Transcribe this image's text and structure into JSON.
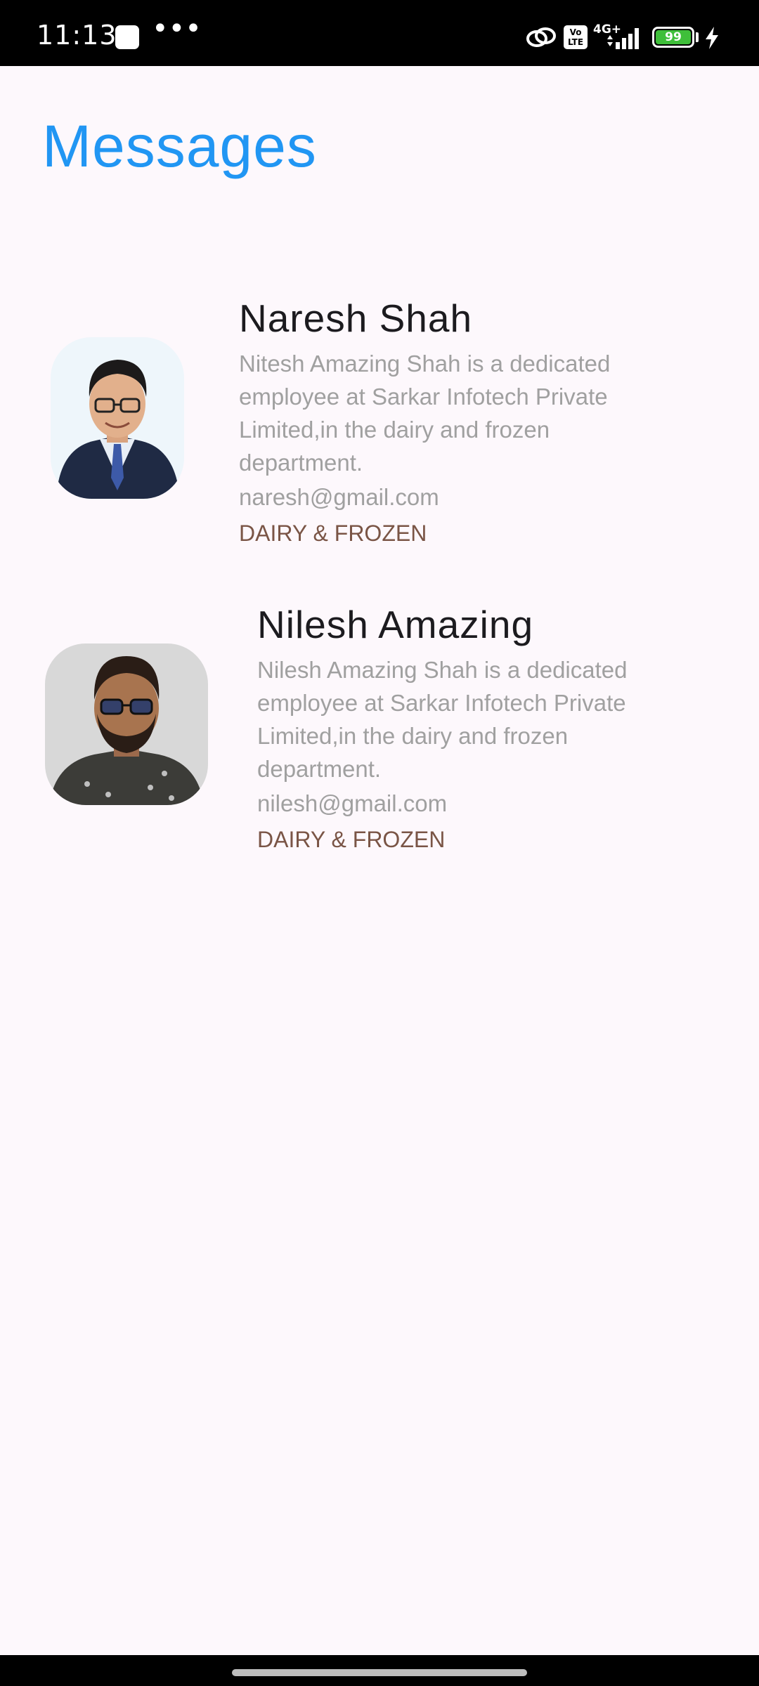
{
  "status_bar": {
    "time": "11:13",
    "dots": "•••",
    "volte": "Vo LTE",
    "network": "4G+",
    "battery": "99",
    "battery_color": "#3fbf3a"
  },
  "header": {
    "title": "Messages",
    "title_color": "#2196f3"
  },
  "messages": [
    {
      "name": "Naresh Shah",
      "description": "Nitesh Amazing Shah is a dedicated employee at Sarkar Infotech Private Limited,in the dairy and frozen department.",
      "email": "naresh@gmail.com",
      "department": "DAIRY & FROZEN"
    },
    {
      "name": "Nilesh Amazing",
      "description": "Nilesh Amazing Shah is a dedicated employee at Sarkar Infotech Private Limited,in the dairy and frozen department.",
      "email": "nilesh@gmail.com",
      "department": "DAIRY & FROZEN"
    }
  ],
  "colors": {
    "background": "#fdf8fc",
    "name": "#1c1b1f",
    "secondary_text": "#a0a0a0",
    "department": "#7a5546"
  }
}
